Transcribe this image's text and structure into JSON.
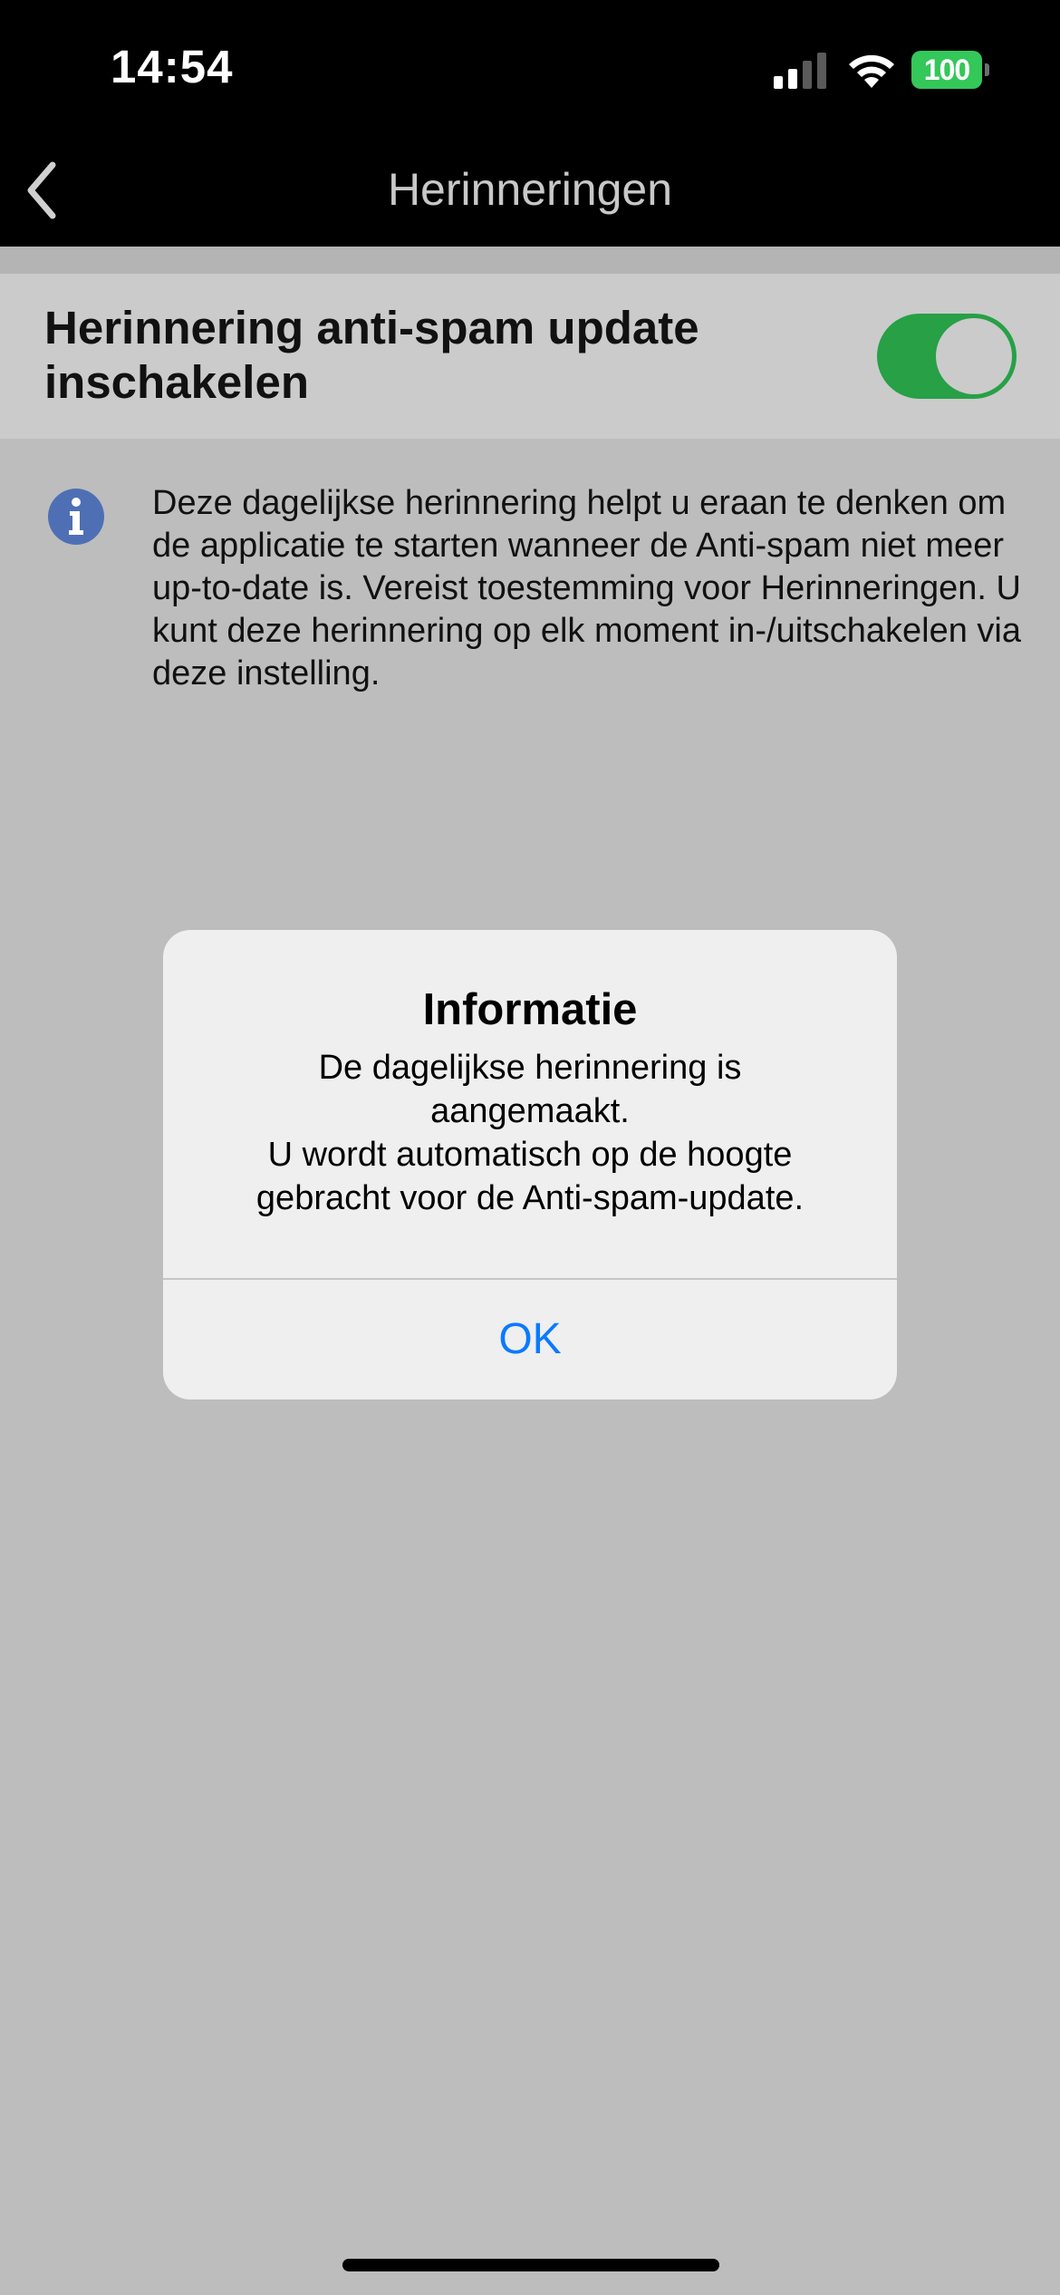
{
  "status_bar": {
    "time": "14:54",
    "battery_level": "100",
    "signal_icon": "cellular-signal-icon",
    "wifi_icon": "wifi-icon"
  },
  "nav": {
    "title": "Herinneringen",
    "back_icon": "chevron-left-icon"
  },
  "setting": {
    "label": "Herinnering anti-spam update inschakelen",
    "enabled": true,
    "toggle_color": "#27a046"
  },
  "info": {
    "icon": "info-icon",
    "text": "Deze dagelijkse herinnering helpt u eraan te denken om de applicatie te starten wanneer de Anti-spam niet meer up-to-date is. Vereist toestemming voor Herinneringen. U kunt deze herinnering op elk moment in-/uitschakelen via deze instelling."
  },
  "alert": {
    "title": "Informatie",
    "message": "De dagelijkse herinnering is\naangemaakt.\nU wordt automatisch op de hoogte\ngebracht voor de Anti-spam-update.",
    "ok_label": "OK",
    "ok_color": "#0a7aff"
  }
}
